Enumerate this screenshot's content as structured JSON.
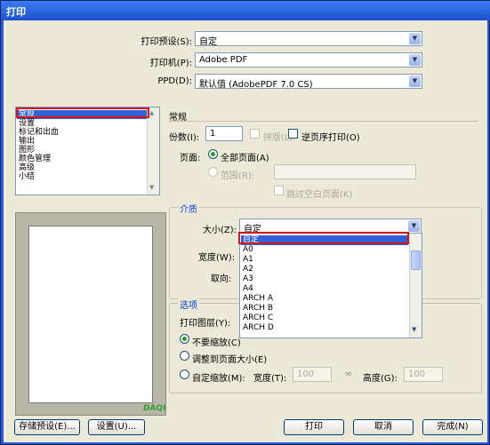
{
  "window": {
    "title": "打印"
  },
  "top": {
    "preset_label": "打印预设(S):",
    "preset_value": "自定",
    "printer_label": "打印机(P):",
    "printer_value": "Adobe PDF",
    "ppd_label": "PPD(D):",
    "ppd_value": "默认值 (AdobePDF 7.0 CS)"
  },
  "sidebar": {
    "items": [
      "常规",
      "设置",
      "标记和出血",
      "输出",
      "图形",
      "颜色管理",
      "高级",
      "小结"
    ]
  },
  "preview": {
    "watermark": "DAQI"
  },
  "general": {
    "heading": "常规",
    "copies_label": "份数(I):",
    "copies_value": "1",
    "collate_label": "拼版(L)",
    "reverse_label": "逆页序打印(O)",
    "pages_label": "页面:",
    "all_pages_label": "全部页面(A)",
    "range_label": "范围(R):",
    "skip_blank_label": "跳过空白页面(K)"
  },
  "media": {
    "group_label": "介质",
    "size_label": "大小(Z):",
    "size_value": "自定",
    "width_label": "宽度(W):",
    "orientation_label": "取向:",
    "size_options": [
      "自定",
      "A0",
      "A1",
      "A2",
      "A3",
      "A4",
      "ARCH A",
      "ARCH B",
      "ARCH C",
      "ARCH D"
    ]
  },
  "options": {
    "group_label": "选项",
    "layers_label": "打印图层(Y):",
    "no_scale_label": "不要缩放(C)",
    "fit_page_label": "调整到页面大小(E)",
    "custom_scale_label": "自定缩放(M):",
    "width_label": "宽度(T):",
    "width_value": "100",
    "height_label": "高度(G):",
    "height_value": "100"
  },
  "buttons": {
    "save_preset": "存储预设(E)...",
    "setup": "设置(U)...",
    "print": "打印",
    "cancel": "取消",
    "done": "完成(N)"
  }
}
